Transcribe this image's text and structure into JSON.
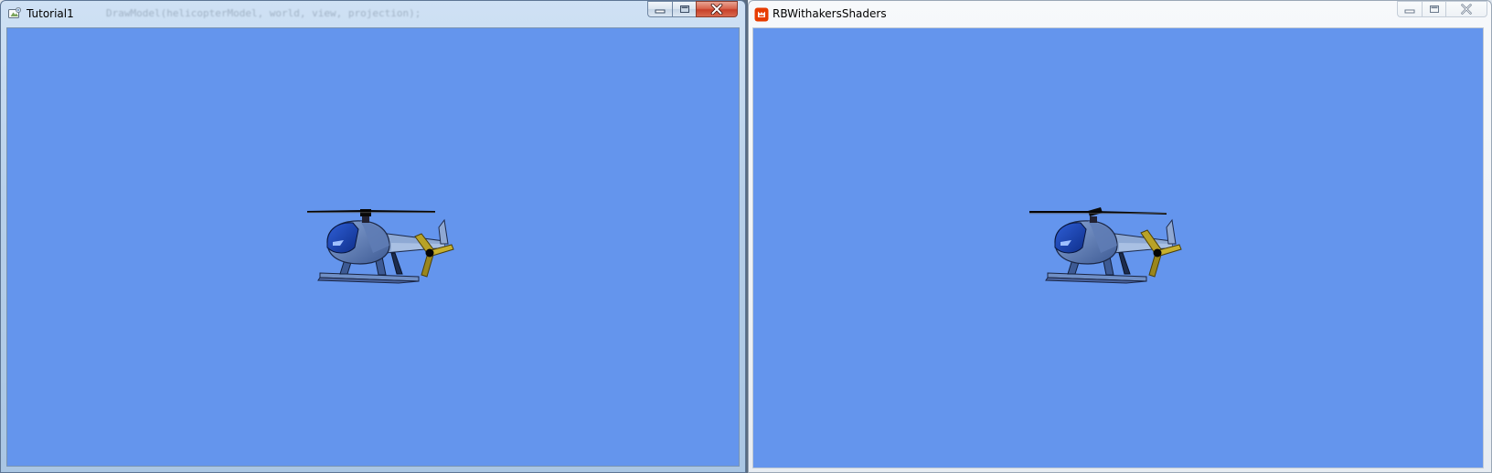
{
  "desktop": {
    "windows": [
      {
        "id": "tutorial1",
        "title": "Tutorial1",
        "background_code_text": "DrawModel(helicopterModel, world, view, projection);",
        "state": "active",
        "icon": "generic-app-icon",
        "clear_color": "#6495ED",
        "caption_buttons": [
          "minimize",
          "maximize",
          "close"
        ]
      },
      {
        "id": "rbwithakersshaders",
        "title": "RBWithakersShaders",
        "state": "inactive",
        "icon": "monogame-icon",
        "clear_color": "#6495ED",
        "caption_buttons": [
          "minimize",
          "maximize",
          "close"
        ]
      }
    ]
  },
  "colors": {
    "cornflower_blue": "#6495ED",
    "close_red": "#C7402A",
    "monogame_orange": "#E73C00"
  }
}
